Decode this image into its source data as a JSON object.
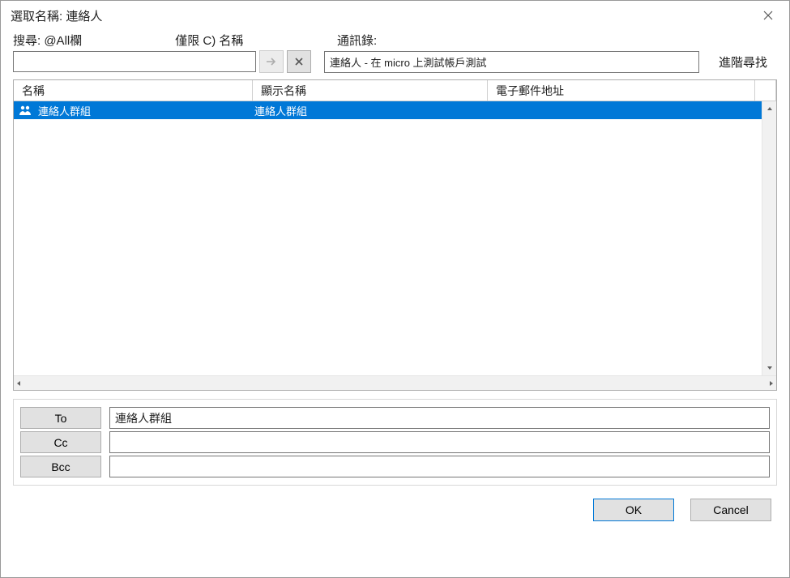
{
  "titlebar": {
    "title": "選取名稱: 連絡人"
  },
  "labels": {
    "search": "搜尋: @All欄",
    "name_only": "僅限 C) 名稱",
    "address_book": "通訊錄:",
    "advanced_find": "進階尋找"
  },
  "search": {
    "value": ""
  },
  "address_book_selected": "連絡人 - 在 micro 上測試帳戶測試",
  "columns": {
    "name": "名稱",
    "display": "顯示名稱",
    "email": "電子郵件地址"
  },
  "rows": [
    {
      "icon": "group",
      "name": "連絡人群組",
      "display": "連絡人群組",
      "email": "",
      "selected": true
    }
  ],
  "recipients": {
    "to_label": "To",
    "cc_label": "Cc",
    "bcc_label": "Bcc",
    "to_value": "連絡人群組",
    "cc_value": "",
    "bcc_value": ""
  },
  "buttons": {
    "ok": "OK",
    "cancel": "Cancel"
  }
}
